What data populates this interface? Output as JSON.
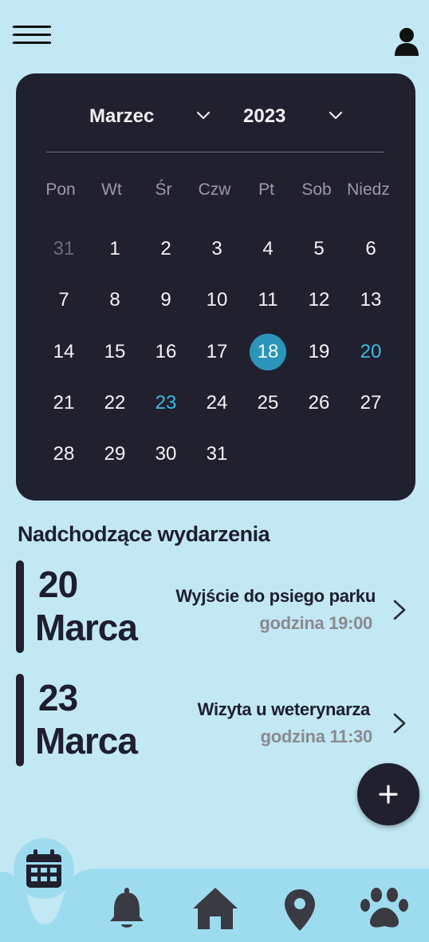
{
  "header": {
    "menu_icon": "hamburger-menu-icon",
    "profile_icon": "user-profile-icon"
  },
  "calendar": {
    "month": "Marzec",
    "year": "2023",
    "weekdays": [
      "Pon",
      "Wt",
      "Śr",
      "Czw",
      "Pt",
      "Sob",
      "Niedz"
    ],
    "weeks": [
      [
        "31",
        "1",
        "2",
        "3",
        "4",
        "5",
        "6"
      ],
      [
        "7",
        "8",
        "9",
        "10",
        "11",
        "12",
        "13"
      ],
      [
        "14",
        "15",
        "16",
        "17",
        "18",
        "19",
        "20"
      ],
      [
        "21",
        "22",
        "23",
        "24",
        "25",
        "26",
        "27"
      ],
      [
        "28",
        "29",
        "30",
        "31",
        "",
        "",
        ""
      ]
    ],
    "today": "18",
    "event_days": [
      "20",
      "23"
    ],
    "colors": {
      "background": "#21202e",
      "today_circle": "#2a95b8",
      "event_day": "#3fb8e6"
    }
  },
  "upcoming": {
    "title": "Nadchodzące wydarzenia",
    "events": [
      {
        "day": "20",
        "month": "Marca",
        "title": "Wyjście do psiego parku",
        "time": "godzina 19:00"
      },
      {
        "day": "23",
        "month": "Marca",
        "title": "Wizyta u weterynarza",
        "time": "godzina 11:30"
      }
    ]
  },
  "fab": {
    "label": "+",
    "icon": "plus-icon"
  },
  "nav": {
    "items": [
      "calendar-icon",
      "bell-icon",
      "home-icon",
      "location-pin-icon",
      "paw-icon"
    ],
    "active": "calendar-icon"
  },
  "colors": {
    "page_background": "#c2e8f4",
    "nav_background": "#9ddcef",
    "dark": "#21202e"
  }
}
